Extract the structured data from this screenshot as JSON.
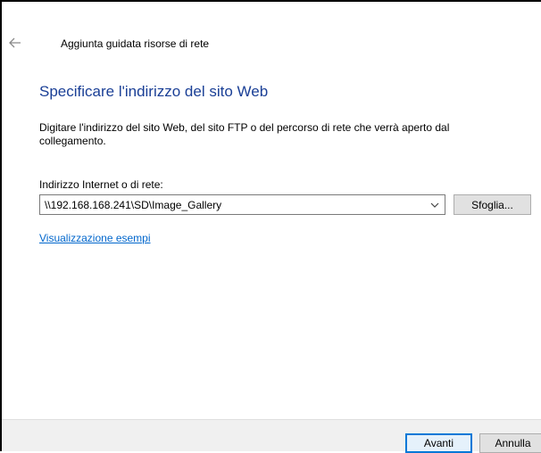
{
  "wizard": {
    "title": "Aggiunta guidata risorse di rete",
    "back_icon": "back-arrow-icon"
  },
  "page": {
    "heading": "Specificare l'indirizzo del sito Web",
    "description": "Digitare l'indirizzo del sito Web, del sito FTP o del percorso di rete che verrà aperto dal collegamento."
  },
  "address": {
    "label": "Indirizzo Internet o di rete:",
    "value": "\\\\192.168.168.241\\SD\\Image_Gallery",
    "dropdown_icon": "chevron-down-icon",
    "browse_label": "Sfoglia..."
  },
  "examples_link": "Visualizzazione esempi",
  "footer": {
    "next_label": "Avanti",
    "cancel_label": "Annulla"
  },
  "colors": {
    "heading": "#1a3f96",
    "link": "#0066cc",
    "focus_border": "#0078d7"
  }
}
